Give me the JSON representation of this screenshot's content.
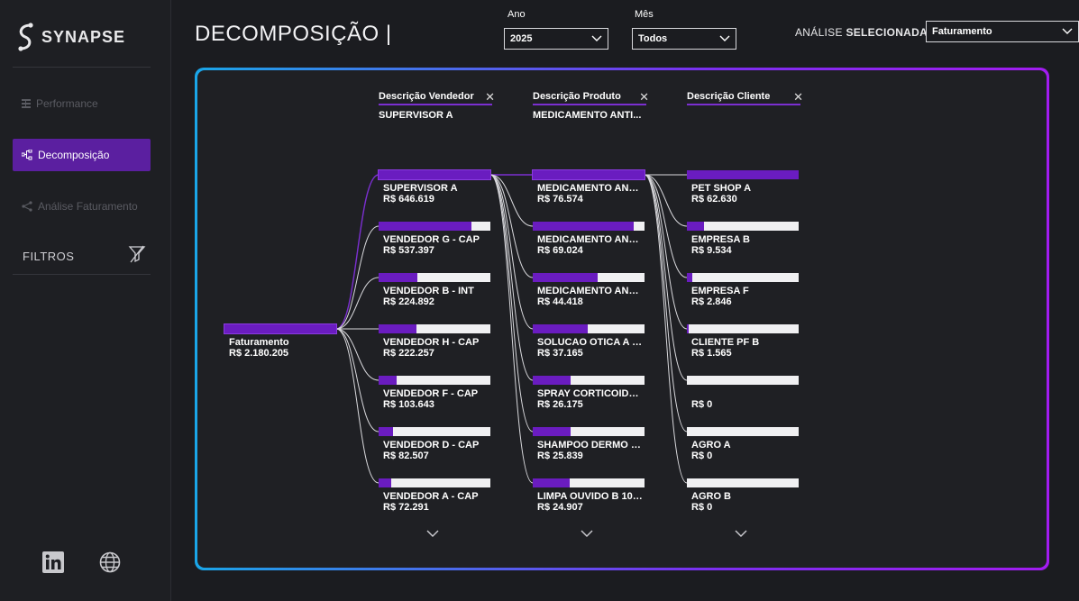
{
  "sidebar": {
    "brand": "SYNAPSE",
    "nav": [
      {
        "label": "Performance",
        "icon": "grid-icon"
      },
      {
        "label": "Decomposição",
        "icon": "tree-icon"
      },
      {
        "label": "Análise Faturamento",
        "icon": "share-icon"
      }
    ],
    "filters_label": "FILTROS",
    "social": [
      "linkedin-icon",
      "globe-icon"
    ]
  },
  "header": {
    "title": "DECOMPOSIÇÃO |",
    "year_label": "Ano",
    "year_value": "2025",
    "month_label": "Mês",
    "month_value": "Todos",
    "analysis_label_prefix": "ANÁLISE ",
    "analysis_label_bold": "SELECIONADA:",
    "analysis_value": "Faturamento"
  },
  "tree": {
    "root": {
      "name": "Faturamento",
      "value": "R$ 2.180.205",
      "fill": 1.0
    },
    "columns": [
      {
        "title": "Descrição Vendedor",
        "selected": "SUPERVISOR A",
        "nodes": [
          {
            "name": "SUPERVISOR A",
            "value": "R$ 646.619",
            "fill": 1.0
          },
          {
            "name": "VENDEDOR G - CAP",
            "value": "R$ 537.397",
            "fill": 0.83
          },
          {
            "name": "VENDEDOR B - INT",
            "value": "R$ 224.892",
            "fill": 0.35
          },
          {
            "name": "VENDEDOR H - CAP",
            "value": "R$ 222.257",
            "fill": 0.34
          },
          {
            "name": "VENDEDOR F - CAP",
            "value": "R$ 103.643",
            "fill": 0.16
          },
          {
            "name": "VENDEDOR D - CAP",
            "value": "R$ 82.507",
            "fill": 0.13
          },
          {
            "name": "VENDEDOR A - CAP",
            "value": "R$ 72.291",
            "fill": 0.11
          }
        ]
      },
      {
        "title": "Descrição Produto",
        "selected": "MEDICAMENTO ANTI...",
        "nodes": [
          {
            "name": "MEDICAMENTO ANTI...",
            "value": "R$ 76.574",
            "fill": 1.0
          },
          {
            "name": "MEDICAMENTO ANTI...",
            "value": "R$ 69.024",
            "fill": 0.9
          },
          {
            "name": "MEDICAMENTO ANTI...",
            "value": "R$ 44.418",
            "fill": 0.58
          },
          {
            "name": "SOLUCAO OTICA A 10...",
            "value": "R$ 37.165",
            "fill": 0.49
          },
          {
            "name": "SPRAY CORTICOIDE A...",
            "value": "R$ 26.175",
            "fill": 0.34
          },
          {
            "name": "SHAMPOO DERMO B ...",
            "value": "R$ 25.839",
            "fill": 0.34
          },
          {
            "name": "LIMPA OUVIDO B 100...",
            "value": "R$ 24.907",
            "fill": 0.33
          }
        ]
      },
      {
        "title": "Descrição Cliente",
        "selected": "",
        "nodes": [
          {
            "name": "PET SHOP A",
            "value": "R$ 62.630",
            "fill": 1.0
          },
          {
            "name": "EMPRESA B",
            "value": "R$ 9.534",
            "fill": 0.15
          },
          {
            "name": "EMPRESA F",
            "value": "R$ 2.846",
            "fill": 0.05
          },
          {
            "name": "CLIENTE PF B",
            "value": "R$ 1.565",
            "fill": 0.02
          },
          {
            "name": "",
            "value": "R$ 0",
            "fill": 0.0
          },
          {
            "name": "AGRO A",
            "value": "R$ 0",
            "fill": 0.0
          },
          {
            "name": "AGRO B",
            "value": "R$ 0",
            "fill": 0.0
          }
        ]
      }
    ]
  }
}
